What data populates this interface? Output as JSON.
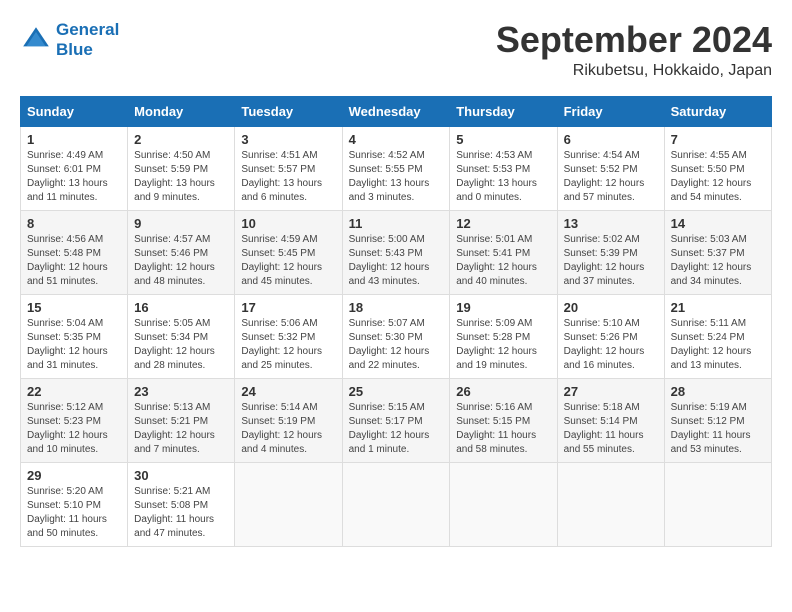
{
  "header": {
    "logo_line1": "General",
    "logo_line2": "Blue",
    "month_title": "September 2024",
    "location": "Rikubetsu, Hokkaido, Japan"
  },
  "weekdays": [
    "Sunday",
    "Monday",
    "Tuesday",
    "Wednesday",
    "Thursday",
    "Friday",
    "Saturday"
  ],
  "weeks": [
    [
      {
        "day": "1",
        "info": "Sunrise: 4:49 AM\nSunset: 6:01 PM\nDaylight: 13 hours and 11 minutes."
      },
      {
        "day": "2",
        "info": "Sunrise: 4:50 AM\nSunset: 5:59 PM\nDaylight: 13 hours and 9 minutes."
      },
      {
        "day": "3",
        "info": "Sunrise: 4:51 AM\nSunset: 5:57 PM\nDaylight: 13 hours and 6 minutes."
      },
      {
        "day": "4",
        "info": "Sunrise: 4:52 AM\nSunset: 5:55 PM\nDaylight: 13 hours and 3 minutes."
      },
      {
        "day": "5",
        "info": "Sunrise: 4:53 AM\nSunset: 5:53 PM\nDaylight: 13 hours and 0 minutes."
      },
      {
        "day": "6",
        "info": "Sunrise: 4:54 AM\nSunset: 5:52 PM\nDaylight: 12 hours and 57 minutes."
      },
      {
        "day": "7",
        "info": "Sunrise: 4:55 AM\nSunset: 5:50 PM\nDaylight: 12 hours and 54 minutes."
      }
    ],
    [
      {
        "day": "8",
        "info": "Sunrise: 4:56 AM\nSunset: 5:48 PM\nDaylight: 12 hours and 51 minutes."
      },
      {
        "day": "9",
        "info": "Sunrise: 4:57 AM\nSunset: 5:46 PM\nDaylight: 12 hours and 48 minutes."
      },
      {
        "day": "10",
        "info": "Sunrise: 4:59 AM\nSunset: 5:45 PM\nDaylight: 12 hours and 45 minutes."
      },
      {
        "day": "11",
        "info": "Sunrise: 5:00 AM\nSunset: 5:43 PM\nDaylight: 12 hours and 43 minutes."
      },
      {
        "day": "12",
        "info": "Sunrise: 5:01 AM\nSunset: 5:41 PM\nDaylight: 12 hours and 40 minutes."
      },
      {
        "day": "13",
        "info": "Sunrise: 5:02 AM\nSunset: 5:39 PM\nDaylight: 12 hours and 37 minutes."
      },
      {
        "day": "14",
        "info": "Sunrise: 5:03 AM\nSunset: 5:37 PM\nDaylight: 12 hours and 34 minutes."
      }
    ],
    [
      {
        "day": "15",
        "info": "Sunrise: 5:04 AM\nSunset: 5:35 PM\nDaylight: 12 hours and 31 minutes."
      },
      {
        "day": "16",
        "info": "Sunrise: 5:05 AM\nSunset: 5:34 PM\nDaylight: 12 hours and 28 minutes."
      },
      {
        "day": "17",
        "info": "Sunrise: 5:06 AM\nSunset: 5:32 PM\nDaylight: 12 hours and 25 minutes."
      },
      {
        "day": "18",
        "info": "Sunrise: 5:07 AM\nSunset: 5:30 PM\nDaylight: 12 hours and 22 minutes."
      },
      {
        "day": "19",
        "info": "Sunrise: 5:09 AM\nSunset: 5:28 PM\nDaylight: 12 hours and 19 minutes."
      },
      {
        "day": "20",
        "info": "Sunrise: 5:10 AM\nSunset: 5:26 PM\nDaylight: 12 hours and 16 minutes."
      },
      {
        "day": "21",
        "info": "Sunrise: 5:11 AM\nSunset: 5:24 PM\nDaylight: 12 hours and 13 minutes."
      }
    ],
    [
      {
        "day": "22",
        "info": "Sunrise: 5:12 AM\nSunset: 5:23 PM\nDaylight: 12 hours and 10 minutes."
      },
      {
        "day": "23",
        "info": "Sunrise: 5:13 AM\nSunset: 5:21 PM\nDaylight: 12 hours and 7 minutes."
      },
      {
        "day": "24",
        "info": "Sunrise: 5:14 AM\nSunset: 5:19 PM\nDaylight: 12 hours and 4 minutes."
      },
      {
        "day": "25",
        "info": "Sunrise: 5:15 AM\nSunset: 5:17 PM\nDaylight: 12 hours and 1 minute."
      },
      {
        "day": "26",
        "info": "Sunrise: 5:16 AM\nSunset: 5:15 PM\nDaylight: 11 hours and 58 minutes."
      },
      {
        "day": "27",
        "info": "Sunrise: 5:18 AM\nSunset: 5:14 PM\nDaylight: 11 hours and 55 minutes."
      },
      {
        "day": "28",
        "info": "Sunrise: 5:19 AM\nSunset: 5:12 PM\nDaylight: 11 hours and 53 minutes."
      }
    ],
    [
      {
        "day": "29",
        "info": "Sunrise: 5:20 AM\nSunset: 5:10 PM\nDaylight: 11 hours and 50 minutes."
      },
      {
        "day": "30",
        "info": "Sunrise: 5:21 AM\nSunset: 5:08 PM\nDaylight: 11 hours and 47 minutes."
      },
      {
        "day": "",
        "info": ""
      },
      {
        "day": "",
        "info": ""
      },
      {
        "day": "",
        "info": ""
      },
      {
        "day": "",
        "info": ""
      },
      {
        "day": "",
        "info": ""
      }
    ]
  ]
}
